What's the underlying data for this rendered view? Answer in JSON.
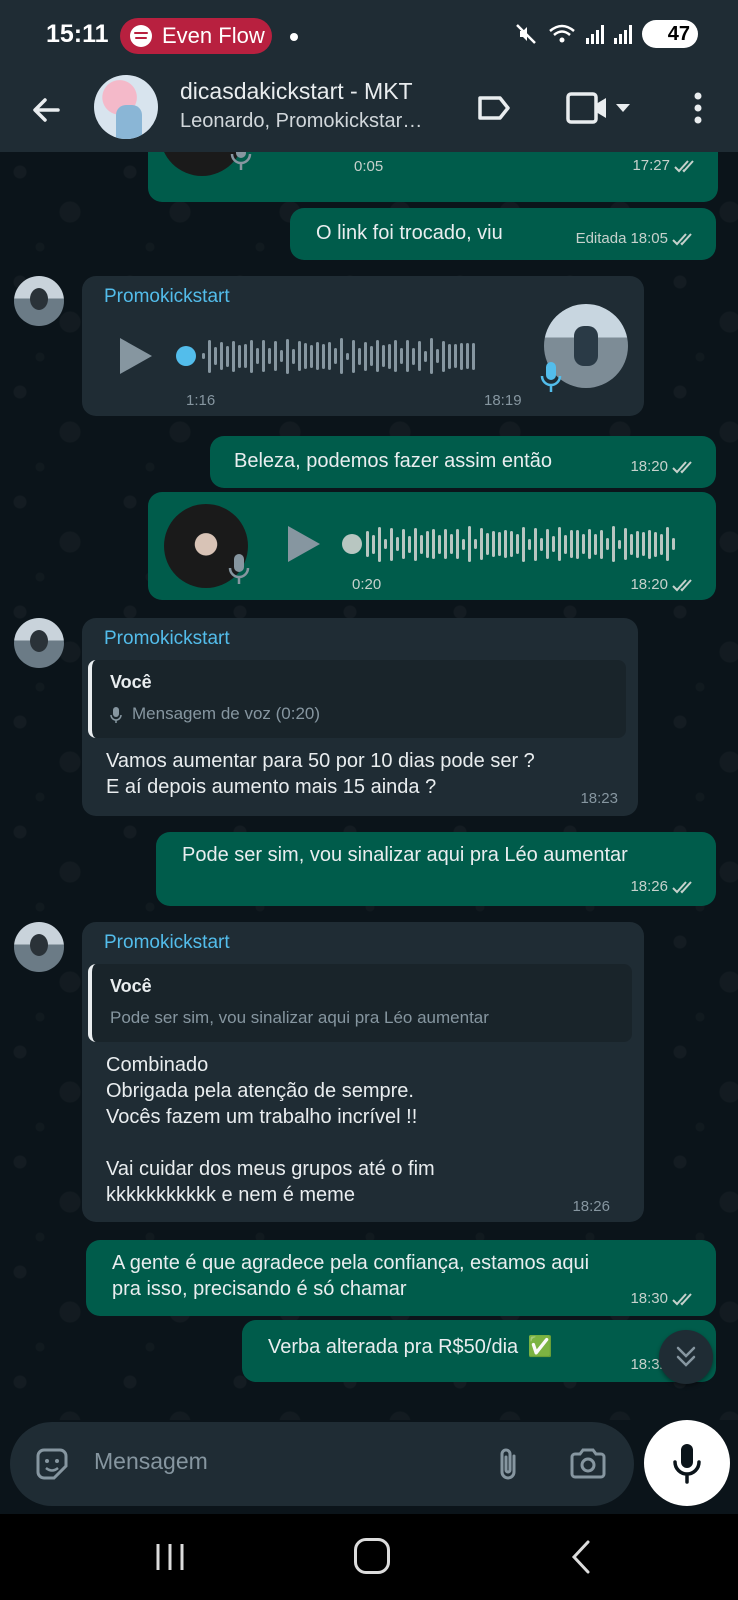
{
  "status_bar": {
    "time": "15:11",
    "media_app": "Even Flow",
    "battery": "47"
  },
  "header": {
    "title": "dicasdakickstart - MKT",
    "subtitle": "Leonardo, Promokickstar…"
  },
  "messages": {
    "m0": {
      "duration": "0:05",
      "time": "17:27"
    },
    "m1": {
      "text": "O link foi trocado, viu",
      "edited": "Editada",
      "time": "18:05"
    },
    "m2": {
      "sender": "Promokickstart",
      "duration": "1:16",
      "time": "18:19"
    },
    "m3": {
      "text": "Beleza, podemos fazer assim então",
      "time": "18:20"
    },
    "m4": {
      "duration": "0:20",
      "time": "18:20"
    },
    "m5": {
      "sender": "Promokickstart",
      "quote_name": "Você",
      "quote_text": "Mensagem de voz (0:20)",
      "line1": "Vamos aumentar para 50 por 10  dias pode ser ?",
      "line2": "E aí depois aumento mais 15 ainda ?",
      "time": "18:23"
    },
    "m6": {
      "text": "Pode ser sim, vou sinalizar aqui pra Léo aumentar",
      "time": "18:26"
    },
    "m7": {
      "sender": "Promokickstart",
      "quote_name": "Você",
      "quote_text": "Pode ser sim, vou sinalizar aqui pra Léo aumentar",
      "line1": "Combinado",
      "line2": "Obrigada pela atenção de sempre.",
      "line3": "Vocês fazem um trabalho incrível !!",
      "line4": "Vai cuidar dos meus grupos até o fim",
      "line5": "kkkkkkkkkkk e nem é meme",
      "time": "18:26"
    },
    "m8": {
      "line1": "A gente é que agradece pela confiança, estamos aqui",
      "line2": "pra isso, precisando é só chamar",
      "time": "18:30"
    },
    "m9": {
      "text": "Verba alterada pra R$50/dia",
      "emoji": "✅",
      "time": "18:32"
    }
  },
  "composer": {
    "placeholder": "Mensagem"
  },
  "icons": {
    "back": "arrow-left-icon",
    "label": "label-icon",
    "video": "video-call-icon",
    "more": "more-vertical-icon",
    "emoji": "sticker-icon",
    "attach": "paperclip-icon",
    "camera": "camera-icon",
    "mic": "microphone-icon"
  },
  "colors": {
    "outgoing_bubble": "#005c4b",
    "incoming_bubble": "#1f2c34",
    "sender_name": "#53bdeb",
    "background": "#0b141a"
  }
}
